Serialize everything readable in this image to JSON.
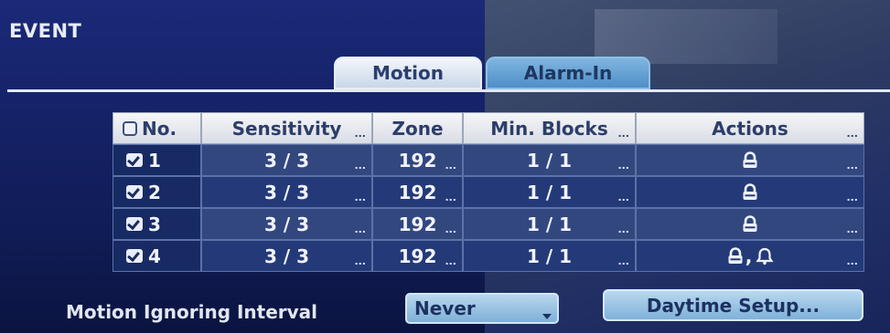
{
  "window": {
    "title": "EVENT"
  },
  "tabs": [
    {
      "label": "Motion",
      "active": true
    },
    {
      "label": "Alarm-In",
      "active": false
    }
  ],
  "table": {
    "headers": {
      "no": "No.",
      "sensitivity": "Sensitivity",
      "zone": "Zone",
      "min_blocks": "Min. Blocks",
      "actions": "Actions"
    },
    "more_glyph": "...",
    "rows": [
      {
        "no": "1",
        "checked": true,
        "sensitivity": "3 / 3",
        "zone": "192",
        "min_blocks": "1 / 1",
        "actions": [
          "lock-icon"
        ]
      },
      {
        "no": "2",
        "checked": true,
        "sensitivity": "3 / 3",
        "zone": "192",
        "min_blocks": "1 / 1",
        "actions": [
          "lock-icon"
        ]
      },
      {
        "no": "3",
        "checked": true,
        "sensitivity": "3 / 3",
        "zone": "192",
        "min_blocks": "1 / 1",
        "actions": [
          "lock-icon"
        ]
      },
      {
        "no": "4",
        "checked": true,
        "sensitivity": "3 / 3",
        "zone": "192",
        "min_blocks": "1 / 1",
        "actions": [
          "lock-icon",
          "bell-icon"
        ]
      }
    ],
    "action_separator": ","
  },
  "footer": {
    "motion_ignoring_label": "Motion Ignoring Interval",
    "motion_ignoring_value": "Never",
    "daytime_button": "Daytime Setup..."
  },
  "colors": {
    "background": "#16236a",
    "header_bg": "#f5f6f8",
    "row_odd": "#33477f",
    "row_even": "#243a78",
    "button_bg": "#9cc4e4",
    "text_light": "#f0f3fa",
    "text_dark": "#1d3160"
  }
}
